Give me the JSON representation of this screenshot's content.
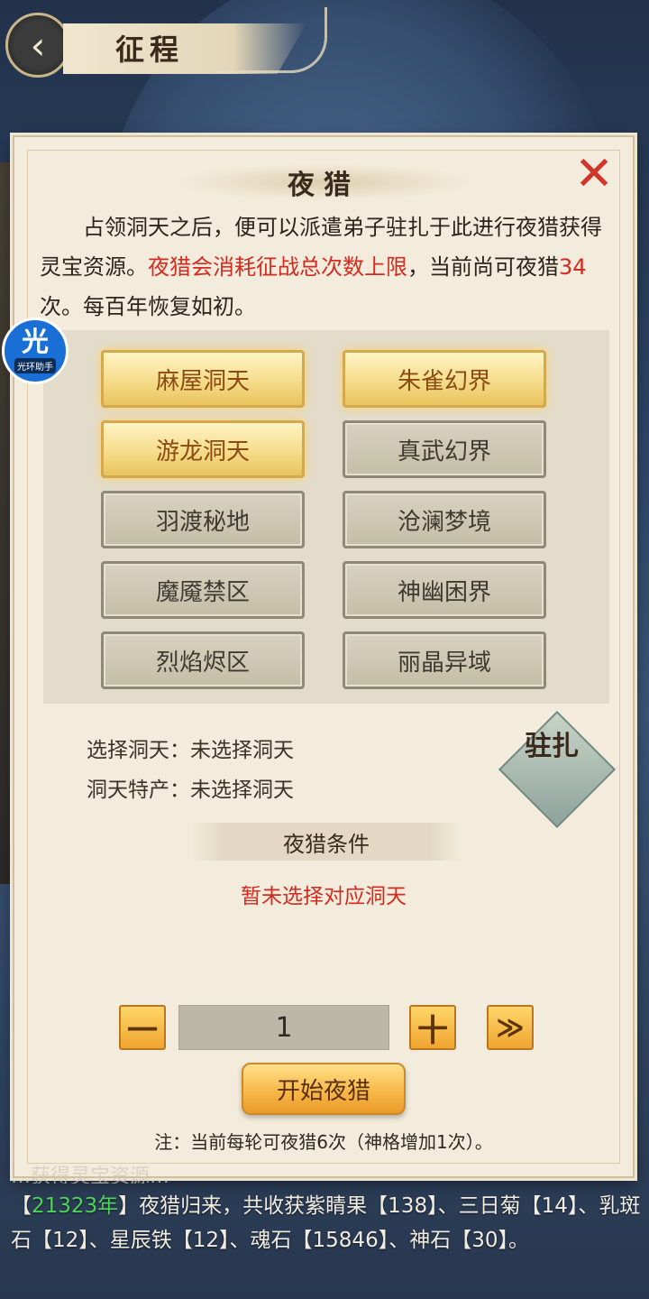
{
  "header": {
    "title": "征程",
    "back_icon": "chevron-left-icon"
  },
  "badge": {
    "char": "光",
    "label": "光环助手"
  },
  "dialog": {
    "title": "夜猎",
    "close_icon": "close-x-icon",
    "intro_part1": "占领洞天之后，便可以派遣弟子驻扎于此进行夜猎获得灵宝资源。",
    "intro_red1": "夜猎会消耗征战总次数上限",
    "intro_part2": "，当前尚可夜猎",
    "intro_count": "34",
    "intro_part3": "次。每百年恢复如初。",
    "zones": [
      {
        "label": "麻屋洞天",
        "active": true
      },
      {
        "label": "朱雀幻界",
        "active": true
      },
      {
        "label": "游龙洞天",
        "active": true
      },
      {
        "label": "真武幻界",
        "active": false
      },
      {
        "label": "羽渡秘地",
        "active": false
      },
      {
        "label": "沧澜梦境",
        "active": false
      },
      {
        "label": "魔魇禁区",
        "active": false
      },
      {
        "label": "神幽困界",
        "active": false
      },
      {
        "label": "烈焰烬区",
        "active": false
      },
      {
        "label": "丽晶异域",
        "active": false
      }
    ],
    "select_label": "选择洞天：",
    "select_value": "未选择洞天",
    "produce_label": "洞天特产：",
    "produce_value": "未选择洞天",
    "station_button": "驻扎",
    "condition_title": "夜猎条件",
    "condition_text": "暂未选择对应洞天",
    "quantity": "1",
    "minus_label": "一",
    "plus_label": "十",
    "max_label": "≫",
    "start_button": "开始夜猎",
    "note": "注：当前每轮可夜猎6次（神格增加1次）。"
  },
  "log": {
    "prev_line": "…获得灵宝资源…",
    "year": "21323年",
    "text_before": "【",
    "text_after": "】夜猎归来，共收获紫睛果【138】、三日菊【14】、乳斑石【12】、星辰铁【12】、魂石【15846】、神石【30】。"
  },
  "colors": {
    "accent_red": "#d42a1f",
    "gold": "#f0a530",
    "log_green": "#4fd35a"
  }
}
